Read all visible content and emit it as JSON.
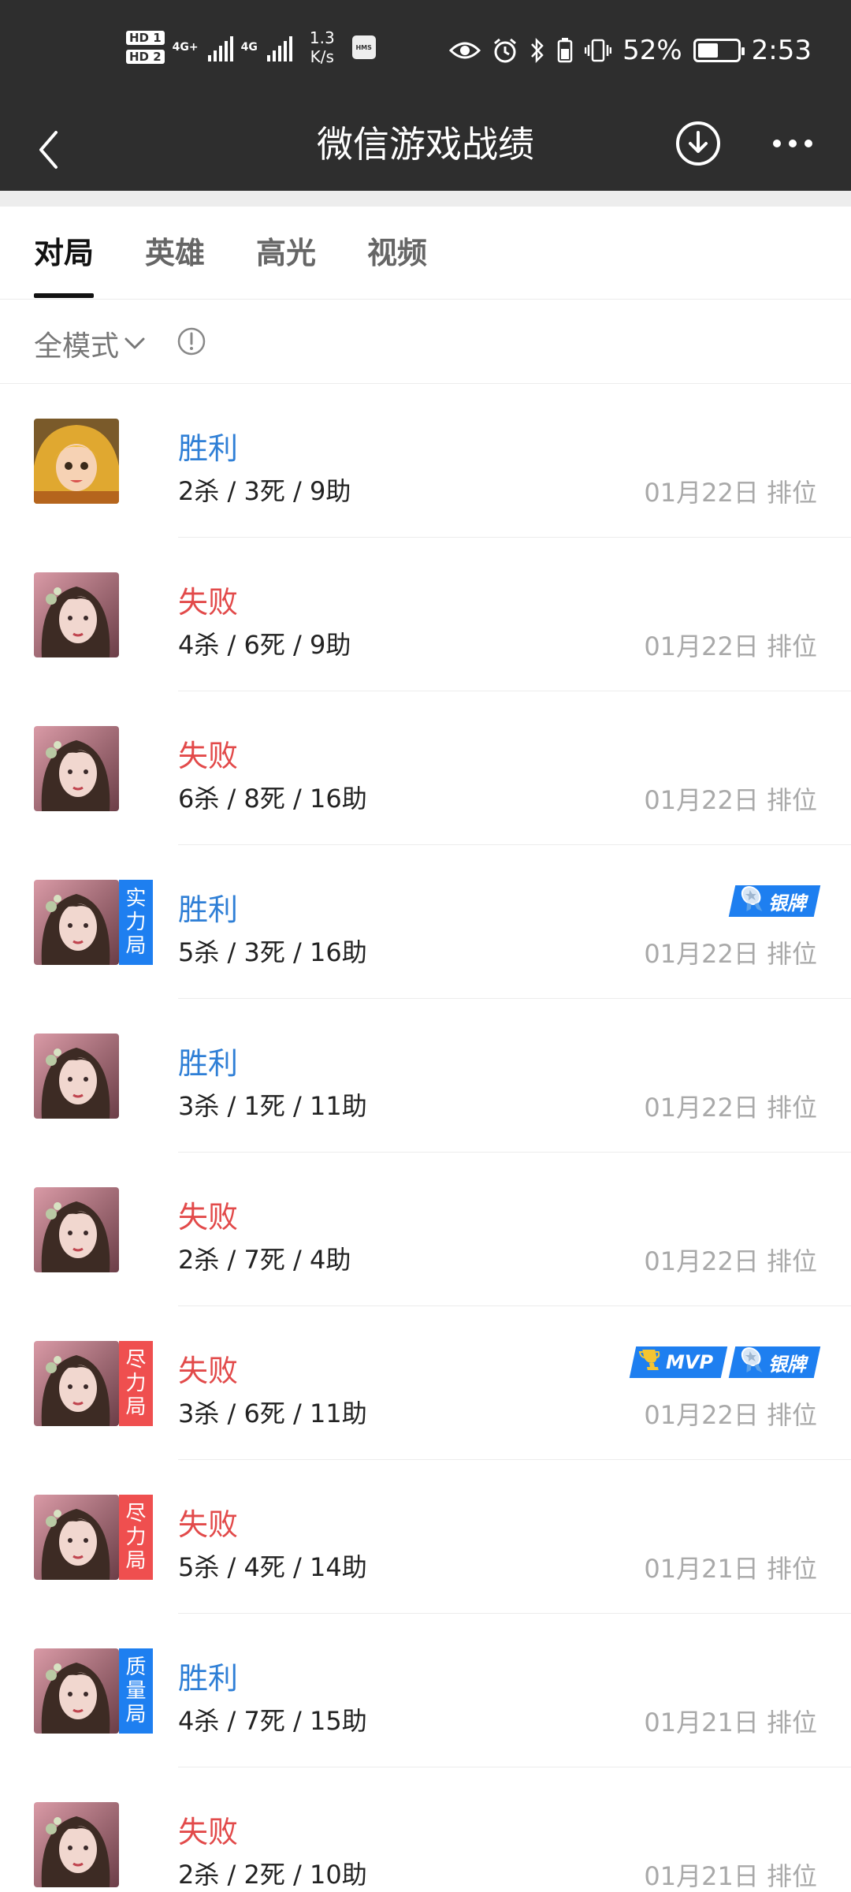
{
  "status_bar": {
    "sim1": "HD 1",
    "sim2": "HD 2",
    "net1": "4G+",
    "net2": "4G",
    "speed_value": "1.3",
    "speed_unit": "K/s",
    "hms": "HMS",
    "battery_percent": "52%",
    "battery_level": 0.52,
    "time": "2:53"
  },
  "title_bar": {
    "title": "微信游戏战绩",
    "back_icon": "chevron-left-icon",
    "download_icon": "download-circle-icon",
    "more_icon": "more-dots-icon"
  },
  "tabs": [
    {
      "label": "对局",
      "active": true
    },
    {
      "label": "英雄",
      "active": false
    },
    {
      "label": "高光",
      "active": false
    },
    {
      "label": "视频",
      "active": false
    }
  ],
  "filter": {
    "mode_label": "全模式",
    "info_icon": "info-circle-icon"
  },
  "matches": [
    {
      "result": "胜利",
      "outcome": "win",
      "kda": "2杀 / 3死 / 9助",
      "meta": "01月22日 排位",
      "hero": "golden-hair-hero",
      "tag": null,
      "badges": []
    },
    {
      "result": "失败",
      "outcome": "lose",
      "kda": "4杀 / 6死 / 9助",
      "meta": "01月22日 排位",
      "hero": "dark-hair-hero",
      "tag": null,
      "badges": []
    },
    {
      "result": "失败",
      "outcome": "lose",
      "kda": "6杀 / 8死 / 16助",
      "meta": "01月22日 排位",
      "hero": "dark-hair-hero",
      "tag": null,
      "badges": []
    },
    {
      "result": "胜利",
      "outcome": "win",
      "kda": "5杀 / 3死 / 16助",
      "meta": "01月22日 排位",
      "hero": "dark-hair-hero",
      "tag": {
        "text": "实力局",
        "color": "#1e7ff0"
      },
      "badges": [
        {
          "text": "银牌",
          "icon": "silver-medal-icon"
        }
      ]
    },
    {
      "result": "胜利",
      "outcome": "win",
      "kda": "3杀 / 1死 / 11助",
      "meta": "01月22日 排位",
      "hero": "dark-hair-hero",
      "tag": null,
      "badges": []
    },
    {
      "result": "失败",
      "outcome": "lose",
      "kda": "2杀 / 7死 / 4助",
      "meta": "01月22日 排位",
      "hero": "dark-hair-hero",
      "tag": null,
      "badges": []
    },
    {
      "result": "失败",
      "outcome": "lose",
      "kda": "3杀 / 6死 / 11助",
      "meta": "01月22日 排位",
      "hero": "dark-hair-hero",
      "tag": {
        "text": "尽力局",
        "color": "#ef4f4f"
      },
      "badges": [
        {
          "text": "MVP",
          "icon": "trophy-icon"
        },
        {
          "text": "银牌",
          "icon": "silver-medal-icon"
        }
      ]
    },
    {
      "result": "失败",
      "outcome": "lose",
      "kda": "5杀 / 4死 / 14助",
      "meta": "01月21日 排位",
      "hero": "dark-hair-hero",
      "tag": {
        "text": "尽力局",
        "color": "#ef4f4f"
      },
      "badges": []
    },
    {
      "result": "胜利",
      "outcome": "win",
      "kda": "4杀 / 7死 / 15助",
      "meta": "01月21日 排位",
      "hero": "dark-hair-hero",
      "tag": {
        "text": "质量局",
        "color": "#1e7ff0"
      },
      "badges": []
    },
    {
      "result": "失败",
      "outcome": "lose",
      "kda": "2杀 / 2死 / 10助",
      "meta": "01月21日 排位",
      "hero": "dark-hair-hero",
      "tag": null,
      "badges": []
    }
  ],
  "colors": {
    "win": "#2f7fd6",
    "lose": "#e24a4a",
    "header_bg": "#2e2e2e",
    "badge_blue": "#1e7ff0"
  }
}
